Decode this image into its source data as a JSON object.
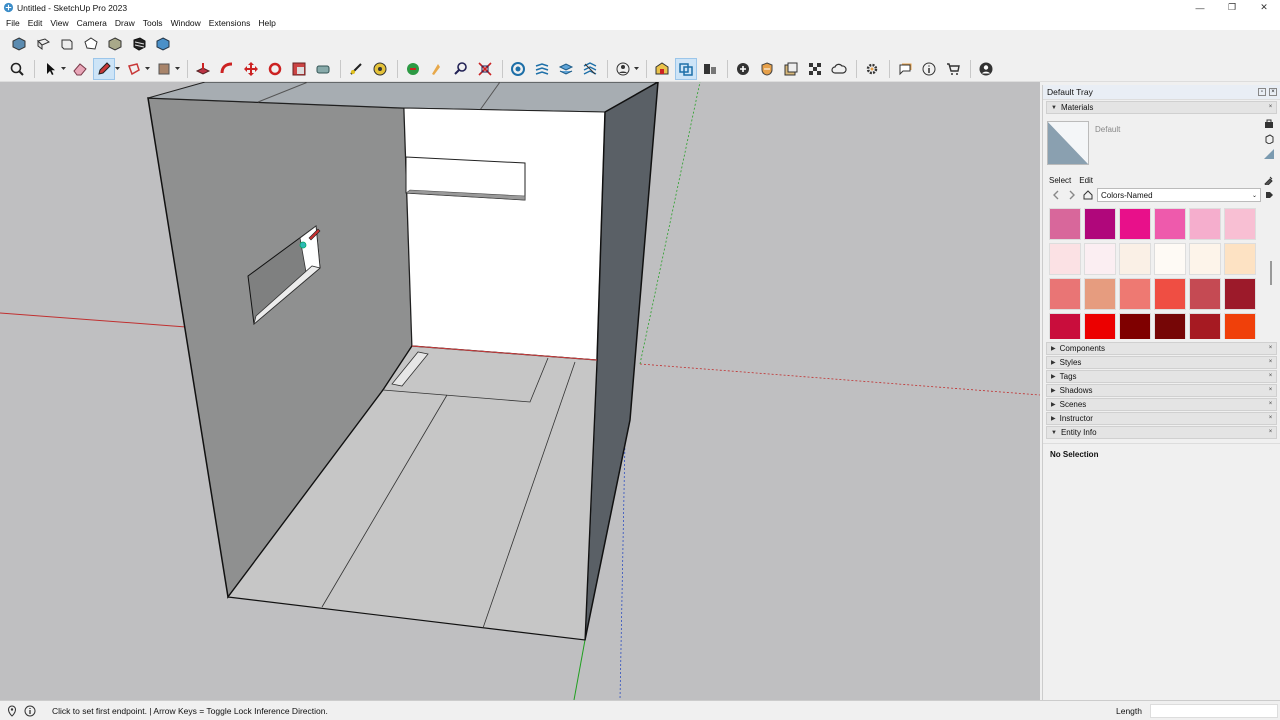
{
  "window": {
    "title": "Untitled - SketchUp Pro 2023",
    "controls": [
      "—",
      "❐",
      "✕"
    ]
  },
  "menu": [
    "File",
    "Edit",
    "View",
    "Camera",
    "Draw",
    "Tools",
    "Window",
    "Extensions",
    "Help"
  ],
  "toolbar_views": [
    "iso-view-icon",
    "top-view-icon",
    "front-view-icon",
    "right-view-icon",
    "back-view-icon",
    "left-view-icon",
    "bottom-view-icon"
  ],
  "toolbar_main": [
    "zoom-extents-icon",
    "select-icon",
    "eraser-icon",
    "pencil-icon",
    "shape-icon",
    "paint-bucket-icon",
    "push-pull-icon",
    "follow-me-icon",
    "move-icon",
    "rotate-icon",
    "scale-icon",
    "tape-measure-icon",
    "protractor-icon",
    "orbit-icon",
    "walk-icon",
    "zoom-icon",
    "zoom-window-icon",
    "section-icon",
    "layers-icon",
    "scenes-icon",
    "sandbox-icon",
    "user-icon",
    "warehouse-icon",
    "solid-tools-icon",
    "components-icon",
    "add-location-icon",
    "styles-icon",
    "materials-icon",
    "matchphoto-icon",
    "cloud-icon",
    "extensions-icon",
    "outliner-icon",
    "info-icon",
    "shop-icon",
    "account-icon"
  ],
  "tray": {
    "title": "Default Tray",
    "materials": {
      "header": "Materials",
      "name": "Default",
      "tabs": [
        "Select",
        "Edit"
      ],
      "library": "Colors-Named",
      "swatches": [
        "#d8679b",
        "#b0077b",
        "#e8108a",
        "#ee5aac",
        "#f5aecd",
        "#f8bfd3",
        "#fbe1e4",
        "#fbeef2",
        "#faf0e6",
        "#fefaf5",
        "#fdf4ea",
        "#fde2c3",
        "#e97575",
        "#e69c7f",
        "#ee7972",
        "#ef4e43",
        "#c54a53",
        "#9c1a2a",
        "#c90d3c",
        "#ec0000",
        "#7f0000",
        "#760606",
        "#a61a22",
        "#f0400a"
      ]
    },
    "panels": [
      "Components",
      "Styles",
      "Tags",
      "Shadows",
      "Scenes",
      "Instructor",
      "Entity Info"
    ],
    "entity_info": "No Selection"
  },
  "status": {
    "message": "Click to set first endpoint. | Arrow Keys = Toggle Lock Inference Direction.",
    "measurement_label": "Length",
    "measurement_value": ""
  }
}
